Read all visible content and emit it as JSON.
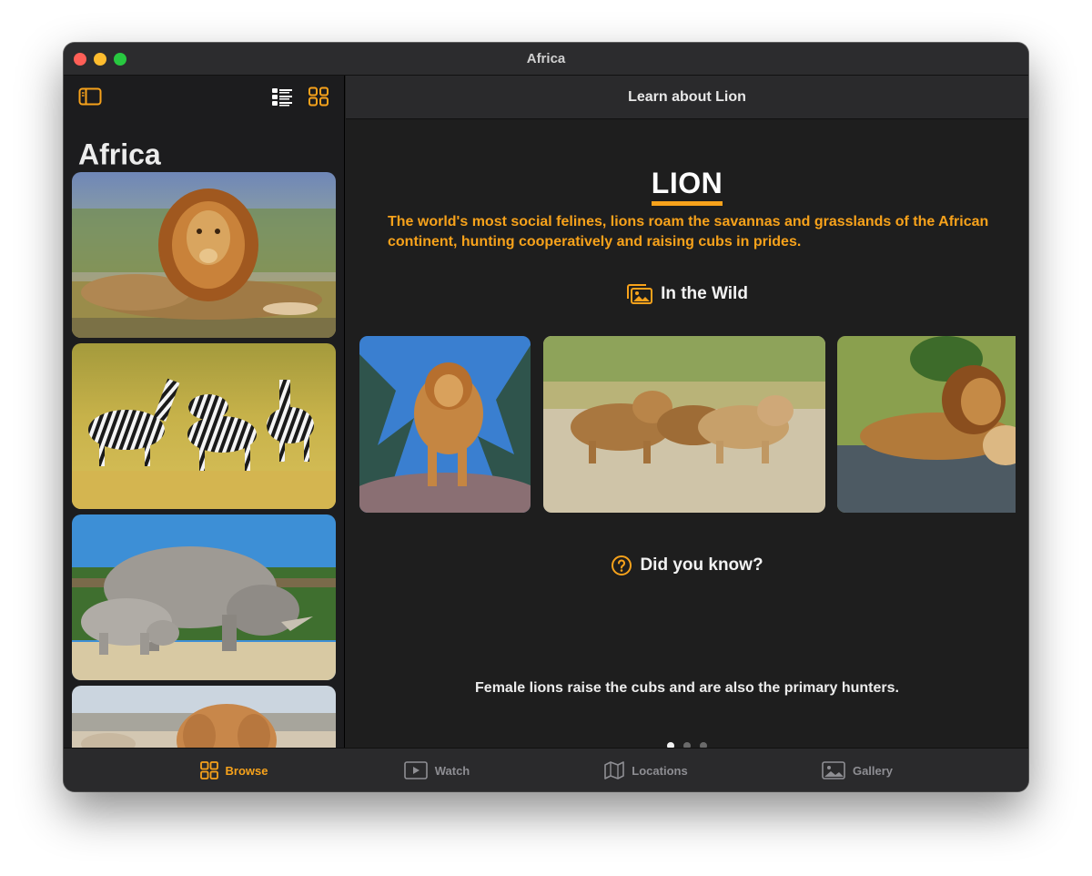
{
  "window": {
    "title": "Africa"
  },
  "sidebar": {
    "title": "Africa",
    "cards": [
      {
        "animal": "lion"
      },
      {
        "animal": "zebras"
      },
      {
        "animal": "rhinos"
      },
      {
        "animal": "elephants"
      }
    ]
  },
  "detail": {
    "nav_title": "Learn about Lion",
    "heading": "LION",
    "intro": "The world's most social felines, lions roam the savannas and grasslands of the African continent, hunting cooperatively and raising cubs in prides.",
    "wild_heading": "In the Wild",
    "did_you_know_heading": "Did you know?",
    "fact": "Female lions raise the cubs and are also the primary hunters.",
    "fact_page": {
      "current": 1,
      "total": 3
    }
  },
  "tabs": [
    {
      "label": "Browse",
      "icon": "grid-icon",
      "selected": true
    },
    {
      "label": "Watch",
      "icon": "play-icon",
      "selected": false
    },
    {
      "label": "Locations",
      "icon": "map-icon",
      "selected": false
    },
    {
      "label": "Gallery",
      "icon": "photo-icon",
      "selected": false
    }
  ],
  "colors": {
    "accent": "#f7a21b",
    "background": "#1e1e1e",
    "sidebar": "#1c1c1e",
    "bar": "#2a2a2c"
  }
}
